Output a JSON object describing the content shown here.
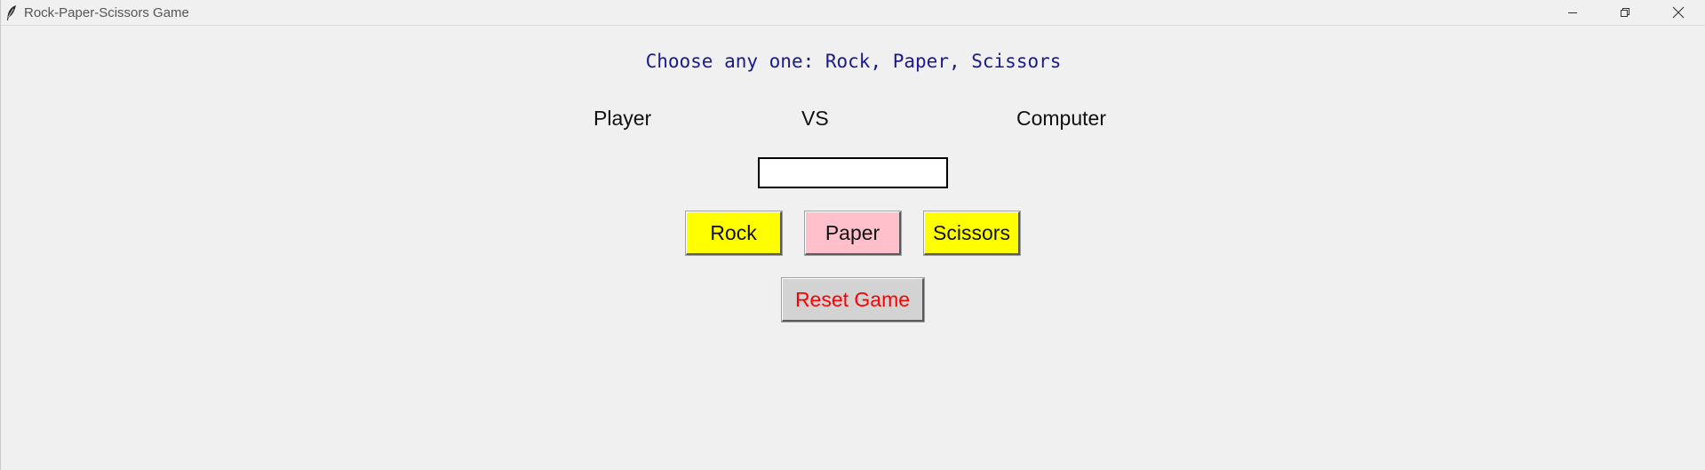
{
  "window": {
    "title": "Rock-Paper-Scissors Game",
    "icon": "feather-icon",
    "controls": [
      "minimize-icon",
      "restore-icon",
      "close-icon"
    ]
  },
  "game": {
    "prompt": "Choose any one: Rock, Paper, Scissors",
    "player_label": "Player",
    "vs_label": "VS",
    "computer_label": "Computer",
    "result_value": ""
  },
  "buttons": {
    "rock": "Rock",
    "paper": "Paper",
    "scissors": "Scissors",
    "reset": "Reset Game"
  },
  "colors": {
    "background": "#f0f0f0",
    "prompt_text": "#1a1a8c",
    "rock_bg": "#ffff00",
    "paper_bg": "#ffc0cb",
    "scissors_bg": "#ffff00",
    "reset_bg": "#d3d3d3",
    "reset_text": "#ff0000"
  }
}
